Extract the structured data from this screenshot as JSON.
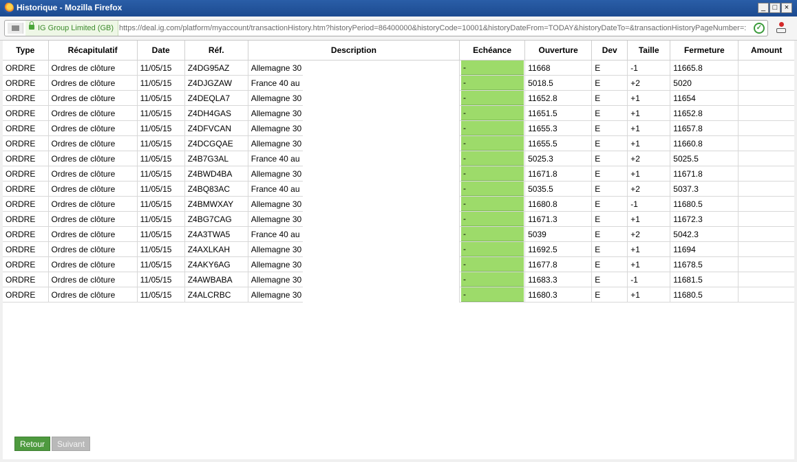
{
  "window": {
    "title": "Historique - Mozilla Firefox",
    "min": "_",
    "max": "□",
    "close": "×"
  },
  "addressbar": {
    "identity": "IG Group Limited (GB)",
    "url": "https://deal.ig.com/platform/myaccount/transactionHistory.htm?historyPeriod=86400000&historyCode=10001&historyDateFrom=TODAY&historyDateTo=&transactionHistoryPageNumber=:",
    "secure_check": "✓"
  },
  "table": {
    "headers": [
      "Type",
      "Récapitulatif",
      "Date",
      "Réf.",
      "Description",
      "Echéance",
      "Ouverture",
      "Dev",
      "Taille",
      "Fermeture",
      "Amount"
    ],
    "rows": [
      {
        "type": "ORDRE",
        "recap": "Ordres de clôture",
        "date": "11/05/15",
        "ref": "Z4DG95AZ",
        "desc": "Allemagne 30",
        "ech": "-",
        "open": "11668",
        "dev": "E",
        "size": "-1",
        "close": "11665.8",
        "amount": ""
      },
      {
        "type": "ORDRE",
        "recap": "Ordres de clôture",
        "date": "11/05/15",
        "ref": "Z4DJGZAW",
        "desc": "France 40 au",
        "ech": "-",
        "open": "5018.5",
        "dev": "E",
        "size": "+2",
        "close": "5020",
        "amount": ""
      },
      {
        "type": "ORDRE",
        "recap": "Ordres de clôture",
        "date": "11/05/15",
        "ref": "Z4DEQLA7",
        "desc": "Allemagne 30",
        "ech": "-",
        "open": "11652.8",
        "dev": "E",
        "size": "+1",
        "close": "11654",
        "amount": ""
      },
      {
        "type": "ORDRE",
        "recap": "Ordres de clôture",
        "date": "11/05/15",
        "ref": "Z4DH4GAS",
        "desc": "Allemagne 30",
        "ech": "-",
        "open": "11651.5",
        "dev": "E",
        "size": "+1",
        "close": "11652.8",
        "amount": ""
      },
      {
        "type": "ORDRE",
        "recap": "Ordres de clôture",
        "date": "11/05/15",
        "ref": "Z4DFVCAN",
        "desc": "Allemagne 30",
        "ech": "-",
        "open": "11655.3",
        "dev": "E",
        "size": "+1",
        "close": "11657.8",
        "amount": ""
      },
      {
        "type": "ORDRE",
        "recap": "Ordres de clôture",
        "date": "11/05/15",
        "ref": "Z4DCGQAE",
        "desc": "Allemagne 30",
        "ech": "-",
        "open": "11655.5",
        "dev": "E",
        "size": "+1",
        "close": "11660.8",
        "amount": ""
      },
      {
        "type": "ORDRE",
        "recap": "Ordres de clôture",
        "date": "11/05/15",
        "ref": "Z4B7G3AL",
        "desc": "France 40 au",
        "ech": "-",
        "open": "5025.3",
        "dev": "E",
        "size": "+2",
        "close": "5025.5",
        "amount": ""
      },
      {
        "type": "ORDRE",
        "recap": "Ordres de clôture",
        "date": "11/05/15",
        "ref": "Z4BWD4BA",
        "desc": "Allemagne 30",
        "ech": "-",
        "open": "11671.8",
        "dev": "E",
        "size": "+1",
        "close": "11671.8",
        "amount": ""
      },
      {
        "type": "ORDRE",
        "recap": "Ordres de clôture",
        "date": "11/05/15",
        "ref": "Z4BQ83AC",
        "desc": "France 40 au",
        "ech": "-",
        "open": "5035.5",
        "dev": "E",
        "size": "+2",
        "close": "5037.3",
        "amount": ""
      },
      {
        "type": "ORDRE",
        "recap": "Ordres de clôture",
        "date": "11/05/15",
        "ref": "Z4BMWXAY",
        "desc": "Allemagne 30",
        "ech": "-",
        "open": "11680.8",
        "dev": "E",
        "size": "-1",
        "close": "11680.5",
        "amount": ""
      },
      {
        "type": "ORDRE",
        "recap": "Ordres de clôture",
        "date": "11/05/15",
        "ref": "Z4BG7CAG",
        "desc": "Allemagne 30",
        "ech": "-",
        "open": "11671.3",
        "dev": "E",
        "size": "+1",
        "close": "11672.3",
        "amount": ""
      },
      {
        "type": "ORDRE",
        "recap": "Ordres de clôture",
        "date": "11/05/15",
        "ref": "Z4A3TWA5",
        "desc": "France 40 au",
        "ech": "-",
        "open": "5039",
        "dev": "E",
        "size": "+2",
        "close": "5042.3",
        "amount": ""
      },
      {
        "type": "ORDRE",
        "recap": "Ordres de clôture",
        "date": "11/05/15",
        "ref": "Z4AXLKAH",
        "desc": "Allemagne 30",
        "ech": "-",
        "open": "11692.5",
        "dev": "E",
        "size": "+1",
        "close": "11694",
        "amount": ""
      },
      {
        "type": "ORDRE",
        "recap": "Ordres de clôture",
        "date": "11/05/15",
        "ref": "Z4AKY6AG",
        "desc": "Allemagne 30",
        "ech": "-",
        "open": "11677.8",
        "dev": "E",
        "size": "+1",
        "close": "11678.5",
        "amount": ""
      },
      {
        "type": "ORDRE",
        "recap": "Ordres de clôture",
        "date": "11/05/15",
        "ref": "Z4AWBABA",
        "desc": "Allemagne 30",
        "ech": "-",
        "open": "11683.3",
        "dev": "E",
        "size": "-1",
        "close": "11681.5",
        "amount": ""
      },
      {
        "type": "ORDRE",
        "recap": "Ordres de clôture",
        "date": "11/05/15",
        "ref": "Z4ALCRBC",
        "desc": "Allemagne 30",
        "ech": "-",
        "open": "11680.3",
        "dev": "E",
        "size": "+1",
        "close": "11680.5",
        "amount": ""
      }
    ]
  },
  "pagination": {
    "back_label": "Retour",
    "next_label": "Suivant"
  },
  "colors": {
    "titlebar": "#1c4a90",
    "echeance_fill": "#9ddb6a",
    "back_button": "#4e9a3f",
    "next_button": "#b9b9b9"
  }
}
